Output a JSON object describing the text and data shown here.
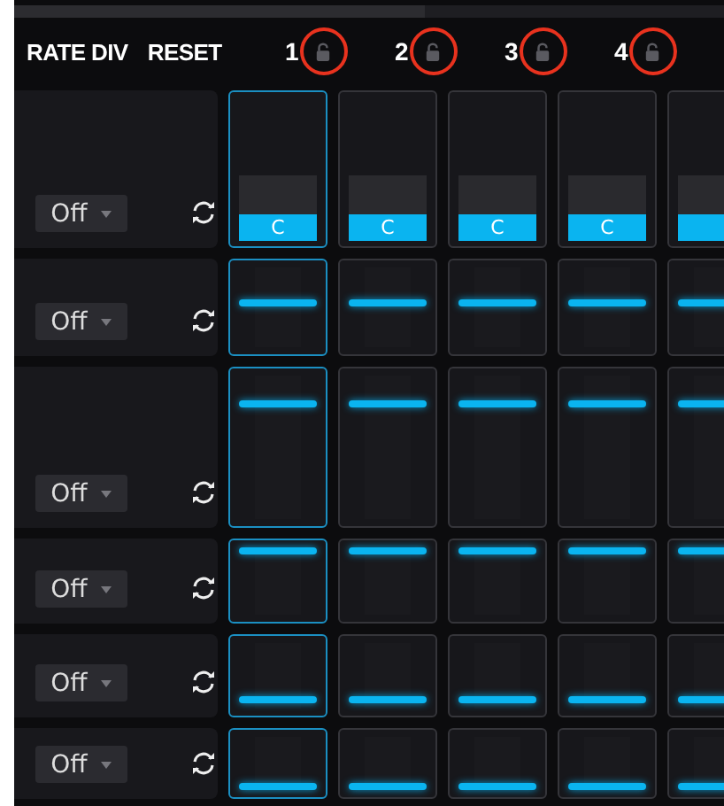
{
  "header": {
    "rate_div": "RATE DIV",
    "reset": "RESET",
    "steps": [
      {
        "number": "1",
        "highlighted": true
      },
      {
        "number": "2",
        "highlighted": true
      },
      {
        "number": "3",
        "highlighted": true
      },
      {
        "number": "4",
        "highlighted": true
      }
    ]
  },
  "rows": [
    {
      "rate_div": "Off",
      "cells": [
        {
          "kind": "note",
          "label": "C",
          "selected": true
        },
        {
          "kind": "note",
          "label": "C",
          "selected": false
        },
        {
          "kind": "note",
          "label": "C",
          "selected": false
        },
        {
          "kind": "note",
          "label": "C",
          "selected": false
        },
        {
          "kind": "note",
          "selected": false
        }
      ]
    },
    {
      "rate_div": "Off",
      "cells": [
        {
          "kind": "value",
          "level": 0.55,
          "selected": true
        },
        {
          "kind": "value",
          "level": 0.55,
          "selected": false
        },
        {
          "kind": "value",
          "level": 0.55,
          "selected": false
        },
        {
          "kind": "value",
          "level": 0.55,
          "selected": false
        },
        {
          "kind": "value",
          "level": 0.55,
          "selected": false
        }
      ]
    },
    {
      "rate_div": "Off",
      "cells": [
        {
          "kind": "value",
          "level": 0.82,
          "selected": true
        },
        {
          "kind": "value",
          "level": 0.82,
          "selected": false
        },
        {
          "kind": "value",
          "level": 0.82,
          "selected": false
        },
        {
          "kind": "value",
          "level": 0.82,
          "selected": false
        },
        {
          "kind": "value",
          "level": 0.82,
          "selected": false
        }
      ]
    },
    {
      "rate_div": "Off",
      "cells": [
        {
          "kind": "value",
          "level": 1,
          "selected": true
        },
        {
          "kind": "value",
          "level": 1,
          "selected": false
        },
        {
          "kind": "value",
          "level": 1,
          "selected": false
        },
        {
          "kind": "value",
          "level": 1,
          "selected": false
        },
        {
          "kind": "value",
          "level": 1,
          "selected": false
        }
      ]
    },
    {
      "rate_div": "Off",
      "cells": [
        {
          "kind": "value",
          "level": 0.1,
          "selected": true
        },
        {
          "kind": "value",
          "level": 0.1,
          "selected": false
        },
        {
          "kind": "value",
          "level": 0.1,
          "selected": false
        },
        {
          "kind": "value",
          "level": 0.1,
          "selected": false
        },
        {
          "kind": "value",
          "level": 0.1,
          "selected": false
        }
      ]
    },
    {
      "rate_div": "Off",
      "cells": [
        {
          "kind": "value",
          "level": 0,
          "selected": true
        },
        {
          "kind": "value",
          "level": 0,
          "selected": false
        },
        {
          "kind": "value",
          "level": 0,
          "selected": false
        },
        {
          "kind": "value",
          "level": 0,
          "selected": false
        },
        {
          "kind": "value",
          "level": 0,
          "selected": false
        }
      ]
    }
  ]
}
